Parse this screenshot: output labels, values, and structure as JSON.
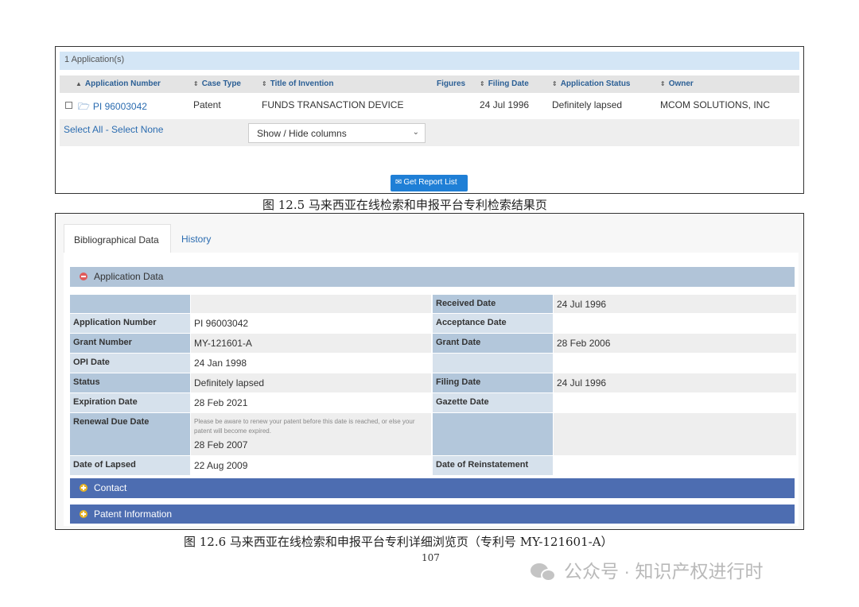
{
  "figure1": {
    "count_label": "1 Application(s)",
    "columns": [
      "Application Number",
      "Case Type",
      "Title of Invention",
      "Figures",
      "Filing Date",
      "Application Status",
      "Owner"
    ],
    "row": {
      "application_number": "PI 96003042",
      "case_type": "Patent",
      "title": "FUNDS TRANSACTION DEVICE",
      "figures": "",
      "filing_date": "24 Jul 1996",
      "status": "Definitely lapsed",
      "owner": "MCOM SOLUTIONS, INC"
    },
    "select_all": "Select All",
    "select_sep": " - ",
    "select_none": "Select None",
    "columns_dropdown": "Show / Hide columns",
    "report_button": "Get Report List",
    "caption": "图 12.5  马来西亚在线检索和申报平台专利检索结果页"
  },
  "figure2": {
    "tabs": [
      "Bibliographical Data",
      "History"
    ],
    "sections": {
      "application_data": "Application Data",
      "contact": "Contact",
      "patent_information": "Patent Information"
    },
    "rows": [
      {
        "l1": "",
        "v1": "",
        "l2": "Received Date",
        "v2": "24 Jul 1996"
      },
      {
        "l1": "Application Number",
        "v1": "PI 96003042",
        "l2": "Acceptance Date",
        "v2": ""
      },
      {
        "l1": "Grant Number",
        "v1": "MY-121601-A",
        "l2": "Grant Date",
        "v2": "28 Feb 2006"
      },
      {
        "l1": "OPI Date",
        "v1": "24 Jan 1998",
        "l2": "",
        "v2": ""
      },
      {
        "l1": "Status",
        "v1": "Definitely lapsed",
        "l2": "Filing Date",
        "v2": "24 Jul 1996"
      },
      {
        "l1": "Expiration Date",
        "v1": "28 Feb 2021",
        "l2": "Gazette Date",
        "v2": ""
      },
      {
        "l1": "Renewal Due Date",
        "v1": "28 Feb 2007",
        "note": "Please be aware to renew your patent before this date is reached, or else your patent will become expired.",
        "l2": "",
        "v2": ""
      },
      {
        "l1": "Date of Lapsed",
        "v1": "22 Aug 2009",
        "l2": "Date of Reinstatement",
        "v2": ""
      }
    ],
    "caption": "图 12.6  马来西亚在线检索和申报平台专利详细浏览页（专利号 MY-121601-A）"
  },
  "page_number": "107",
  "watermark": "公众号 · 知识产权进行时",
  "colors": {
    "header_blue": "#d4e6f6",
    "link_blue": "#2b6cb0",
    "button_blue": "#1f7fd6",
    "section_dark": "#4d6db1",
    "section_light": "#b1c4d8"
  }
}
